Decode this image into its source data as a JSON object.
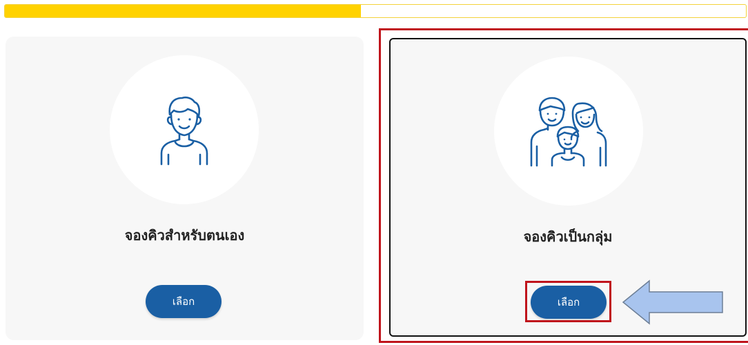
{
  "progress": {
    "fraction": 0.48,
    "fill_color": "#ffd200"
  },
  "options": [
    {
      "title": "จองคิวสำหรับตนเอง",
      "icon": "single-person-icon",
      "button_label": "เลือก"
    },
    {
      "title": "จองคิวเป็นกลุ่ม",
      "icon": "family-group-icon",
      "button_label": "เลือก"
    }
  ],
  "colors": {
    "accent": "#1a5fa4",
    "highlight": "#c0141c",
    "arrow": "#a8c4ee"
  },
  "annotation": {
    "arrow": "arrow-left-icon"
  }
}
